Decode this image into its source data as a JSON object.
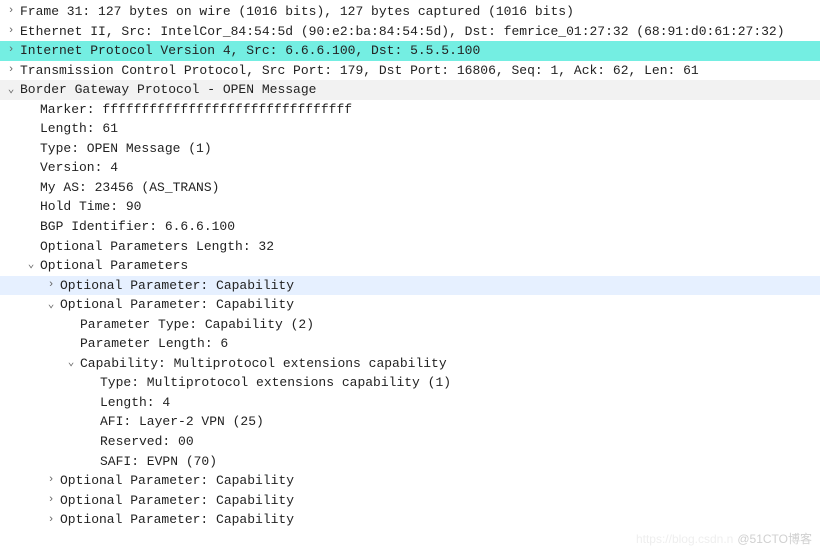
{
  "lines": [
    {
      "indent": 0,
      "toggle": ">",
      "cls": "",
      "text": "Frame 31: 127 bytes on wire (1016 bits), 127 bytes captured (1016 bits)"
    },
    {
      "indent": 0,
      "toggle": ">",
      "cls": "",
      "text": "Ethernet II, Src: IntelCor_84:54:5d (90:e2:ba:84:54:5d), Dst: femrice_01:27:32 (68:91:d0:61:27:32)"
    },
    {
      "indent": 0,
      "toggle": ">",
      "cls": "sel-teal",
      "text": "Internet Protocol Version 4, Src: 6.6.6.100, Dst: 5.5.5.100"
    },
    {
      "indent": 0,
      "toggle": ">",
      "cls": "",
      "text": "Transmission Control Protocol, Src Port: 179, Dst Port: 16806, Seq: 1, Ack: 62, Len: 61"
    },
    {
      "indent": 0,
      "toggle": "v",
      "cls": "hdr-gray",
      "text": "Border Gateway Protocol - OPEN Message"
    },
    {
      "indent": 1,
      "toggle": "",
      "cls": "",
      "text": "Marker: ffffffffffffffffffffffffffffffff"
    },
    {
      "indent": 1,
      "toggle": "",
      "cls": "",
      "text": "Length: 61"
    },
    {
      "indent": 1,
      "toggle": "",
      "cls": "",
      "text": "Type: OPEN Message (1)"
    },
    {
      "indent": 1,
      "toggle": "",
      "cls": "",
      "text": "Version: 4"
    },
    {
      "indent": 1,
      "toggle": "",
      "cls": "",
      "text": "My AS: 23456 (AS_TRANS)"
    },
    {
      "indent": 1,
      "toggle": "",
      "cls": "",
      "text": "Hold Time: 90"
    },
    {
      "indent": 1,
      "toggle": "",
      "cls": "",
      "text": "BGP Identifier: 6.6.6.100"
    },
    {
      "indent": 1,
      "toggle": "",
      "cls": "",
      "text": "Optional Parameters Length: 32"
    },
    {
      "indent": 1,
      "toggle": "v",
      "cls": "",
      "text": "Optional Parameters"
    },
    {
      "indent": 2,
      "toggle": ">",
      "cls": "sel-blue",
      "text": "Optional Parameter: Capability"
    },
    {
      "indent": 2,
      "toggle": "v",
      "cls": "",
      "text": "Optional Parameter: Capability"
    },
    {
      "indent": 3,
      "toggle": "",
      "cls": "",
      "text": "Parameter Type: Capability (2)"
    },
    {
      "indent": 3,
      "toggle": "",
      "cls": "",
      "text": "Parameter Length: 6"
    },
    {
      "indent": 3,
      "toggle": "v",
      "cls": "",
      "text": "Capability: Multiprotocol extensions capability"
    },
    {
      "indent": 4,
      "toggle": "",
      "cls": "",
      "text": "Type: Multiprotocol extensions capability (1)"
    },
    {
      "indent": 4,
      "toggle": "",
      "cls": "",
      "text": "Length: 4"
    },
    {
      "indent": 4,
      "toggle": "",
      "cls": "",
      "text": "AFI: Layer-2 VPN (25)"
    },
    {
      "indent": 4,
      "toggle": "",
      "cls": "",
      "text": "Reserved: 00"
    },
    {
      "indent": 4,
      "toggle": "",
      "cls": "",
      "text": "SAFI: EVPN (70)"
    },
    {
      "indent": 2,
      "toggle": ">",
      "cls": "",
      "text": "Optional Parameter: Capability"
    },
    {
      "indent": 2,
      "toggle": ">",
      "cls": "",
      "text": "Optional Parameter: Capability"
    },
    {
      "indent": 2,
      "toggle": ">",
      "cls": "",
      "text": "Optional Parameter: Capability"
    }
  ],
  "watermark": {
    "faded": "https://blog.csdn.n",
    "strong": "@51CTO博客"
  }
}
